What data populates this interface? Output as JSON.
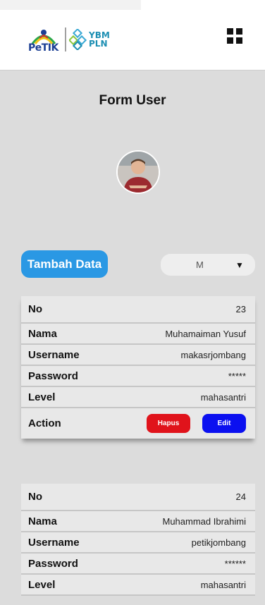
{
  "header": {
    "logo_left_text": "PeTIK",
    "logo_right_line1": "YBM",
    "logo_right_line2": "PLN",
    "menu_icon": "grid-menu-icon"
  },
  "page": {
    "title": "Form User"
  },
  "avatar": {
    "icon": "user-avatar"
  },
  "toolbar": {
    "add_label": "Tambah Data",
    "select_value": "M",
    "select_caret": "▼"
  },
  "records": [
    {
      "no_label": "No",
      "no": "23",
      "nama_label": "Nama",
      "nama": "Muhamaiman Yusuf",
      "username_label": "Username",
      "username": "makasrjombang",
      "password_label": "Password",
      "password": "*****",
      "level_label": "Level",
      "level": "mahasantri",
      "action_label": "Action",
      "delete_label": "Hapus",
      "edit_label": "Edit"
    },
    {
      "no_label": "No",
      "no": "24",
      "nama_label": "Nama",
      "nama": "Muhammad Ibrahimi",
      "username_label": "Username",
      "username": "petikjombang",
      "password_label": "Password",
      "password": "******",
      "level_label": "Level",
      "level": "mahasantri"
    }
  ],
  "colors": {
    "add_button": "#2a98e4",
    "delete_button": "#e0131b",
    "edit_button": "#0b10f0",
    "background": "#dcdcdc"
  }
}
